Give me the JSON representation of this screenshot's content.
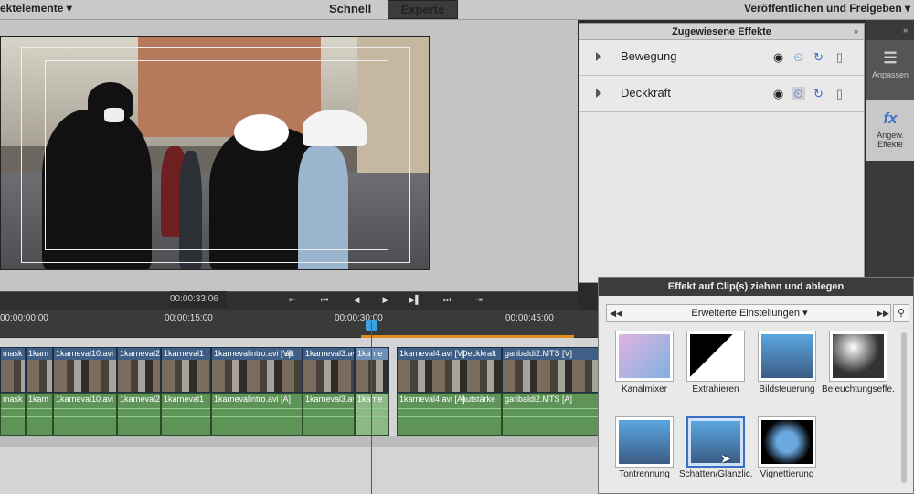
{
  "topbar": {
    "left_menu": "ektelemente",
    "tabs": [
      "Schnell",
      "Experte"
    ],
    "right_menu": "Veröffentlichen und Freigeben"
  },
  "assigned_effects": {
    "title": "Zugewiesene Effekte",
    "rows": [
      {
        "label": "Bewegung"
      },
      {
        "label": "Deckkraft"
      }
    ]
  },
  "rail": {
    "adjust": "Anpassen",
    "applied": "Angew. Effekte",
    "applied_line1": "Angew.",
    "applied_line2": "Effekte",
    "fx_glyph": "fx"
  },
  "transport": {
    "timecode": "00:00:33:06"
  },
  "ruler": {
    "ticks": [
      "00:00:00:00",
      "00:00:15:00",
      "00:00:30:00",
      "00:00:45:00"
    ]
  },
  "tracks": {
    "video": [
      "mask",
      "1kam",
      "1karneval10.avi [V]",
      "1karneval2",
      "1karneval1",
      "1karnevalintro.avi [V]",
      "aft",
      "1karneval3.av",
      "1karne",
      "1karneval4.avi [V]",
      "Deckkraft",
      "garibaldi2.MTS [V]"
    ],
    "audio": [
      "mask",
      "1kam",
      "1karneval10.avi [A]",
      "1karneval2",
      "1karneval1",
      "1karnevalintro.avi [A]",
      "1karneval3.av",
      "1karne",
      "1karneval4.avi [A]",
      "autstärke",
      "garibaldi2.MTS [A]"
    ]
  },
  "browser": {
    "title": "Effekt auf Clip(s) ziehen und ablegen",
    "category": "Erweiterte Einstellungen",
    "effects": [
      "Kanalmixer",
      "Extrahieren",
      "Bildsteuerung",
      "Beleuchtungseffe...",
      "Tontrennung",
      "Schatten/Glanzlic...",
      "Vignettierung"
    ]
  }
}
